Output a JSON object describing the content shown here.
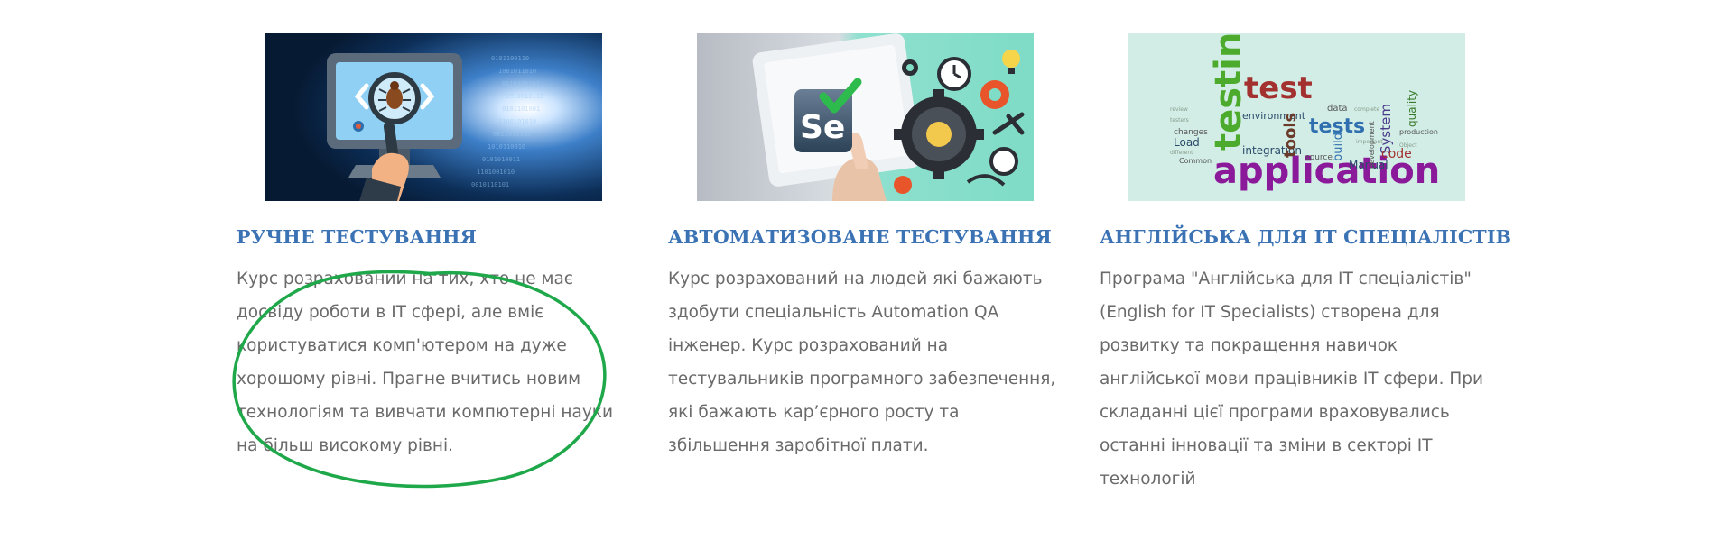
{
  "courses": [
    {
      "title": "РУЧНЕ ТЕСТУВАННЯ",
      "description": "Курс розрахований на тих, хто не має\nдосвіду роботи в IT сфері, але вміє\nкористуватися комп'ютером на дуже\nхорошому рівні. Прагне вчитись новим\nтехнологіям та вивчати компютерні науки\nна більш високому рівні."
    },
    {
      "title": "АВТОМАТИЗОВАНЕ ТЕСТУВАННЯ",
      "description": "Курс розрахований на людей які бажають\nздобути спеціальність Automation QA\nінженер. Курс розрахований на\nтестувальників програмного забезпечення,\nякі бажають кар’єрного росту та\nзбільшення заробітної плати.",
      "image_text": {
        "logo": "Se"
      }
    },
    {
      "title": "АНГЛІЙСЬКА ДЛЯ IT СПЕЦІАЛІСТІВ",
      "description": "Програма \"Англійська для IT спеціалістів\"\n(English for IT Specialists) створена для\nрозвитку та покращення навичок\nанглійської мови працівників IT сфери. При\nскладанні цієї програми враховувались\nостанні інновації та зміни в секторі IT\nтехнологій",
      "image_text": {
        "words": [
          "testing",
          "test",
          "tests",
          "application",
          "environment",
          "integration",
          "tools",
          "quality",
          "System",
          "code",
          "Manual",
          "build",
          "Load",
          "changes",
          "data",
          "production",
          "source",
          "development",
          "Common"
        ]
      }
    }
  ],
  "colors": {
    "title": "#3a72b4",
    "text": "#6a6a6a",
    "annotation": "#1fa84a"
  }
}
